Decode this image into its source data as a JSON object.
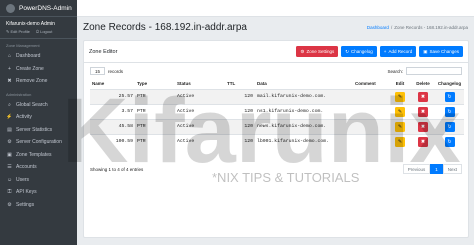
{
  "sidebar": {
    "brand": "PowerDNS-Admin",
    "user": {
      "name": "Kifarunix-demo Admin",
      "edit_profile": "Edit Profile",
      "logout": "Logout"
    },
    "section_zone": "Zone Management",
    "zone_items": [
      {
        "icon": "dashboard-icon",
        "glyph": "⌂",
        "label": "Dashboard"
      },
      {
        "icon": "plus-icon",
        "glyph": "+",
        "label": "Create Zone"
      },
      {
        "icon": "trash-icon",
        "glyph": "✖",
        "label": "Remove Zone"
      }
    ],
    "section_admin": "Administration",
    "admin_items": [
      {
        "icon": "search-icon",
        "glyph": "⌕",
        "label": "Global Search"
      },
      {
        "icon": "activity-icon",
        "glyph": "⚡",
        "label": "Activity"
      },
      {
        "icon": "chart-icon",
        "glyph": "▤",
        "label": "Server Statistics"
      },
      {
        "icon": "gear-icon",
        "glyph": "⚙",
        "label": "Server Configuration"
      },
      {
        "icon": "template-icon",
        "glyph": "▣",
        "label": "Zone Templates"
      },
      {
        "icon": "clipboard-icon",
        "glyph": "☰",
        "label": "Accounts"
      },
      {
        "icon": "users-icon",
        "glyph": "☺",
        "label": "Users"
      },
      {
        "icon": "key-icon",
        "glyph": "⚿",
        "label": "API Keys"
      },
      {
        "icon": "settings-icon",
        "glyph": "⚙",
        "label": "Settings"
      }
    ]
  },
  "header": {
    "title": "Zone Records - 168.192.in-addr.arpa",
    "breadcrumb": {
      "root": "Dashboard",
      "sep": "/",
      "current": "Zone Records - 168.192.in-addr.arpa"
    }
  },
  "editor": {
    "title": "Zone Editor",
    "buttons": {
      "zone_settings": "Zone Settings",
      "changelog": "Changelog",
      "add_record": "Add Record",
      "save_changes": "Save Changes"
    },
    "length_value": "15",
    "length_suffix": "records",
    "search_label": "Search:",
    "search_value": "",
    "columns": [
      "Name",
      "Type",
      "Status",
      "TTL",
      "Data",
      "Comment",
      "Edit",
      "Delete",
      "Changelog"
    ],
    "rows": [
      {
        "name": "25.57",
        "type": "PTR",
        "status": "Active",
        "ttl": "120",
        "data": "mail.kifarunix-demo.com.",
        "comment": ""
      },
      {
        "name": "3.57",
        "type": "PTR",
        "status": "Active",
        "ttl": "120",
        "data": "ns1.kifarunix-demo.com.",
        "comment": ""
      },
      {
        "name": "45.58",
        "type": "PTR",
        "status": "Active",
        "ttl": "120",
        "data": "news.kifarunix-demo.com.",
        "comment": ""
      },
      {
        "name": "100.59",
        "type": "PTR",
        "status": "Active",
        "ttl": "120",
        "data": "lb001.kifarunix-demo.com.",
        "comment": ""
      }
    ],
    "footer_info": "Showing 1 to 4 of 4 entries",
    "pager": {
      "previous": "Previous",
      "page": "1",
      "next": "Next"
    }
  },
  "watermark": {
    "text": "Kifarunix",
    "tagline": "*NIX TIPS & TUTORIALS"
  },
  "colors": {
    "sidebar": "#343a40",
    "primary": "#007bff",
    "danger": "#dc3545",
    "warning": "#ffc107"
  }
}
